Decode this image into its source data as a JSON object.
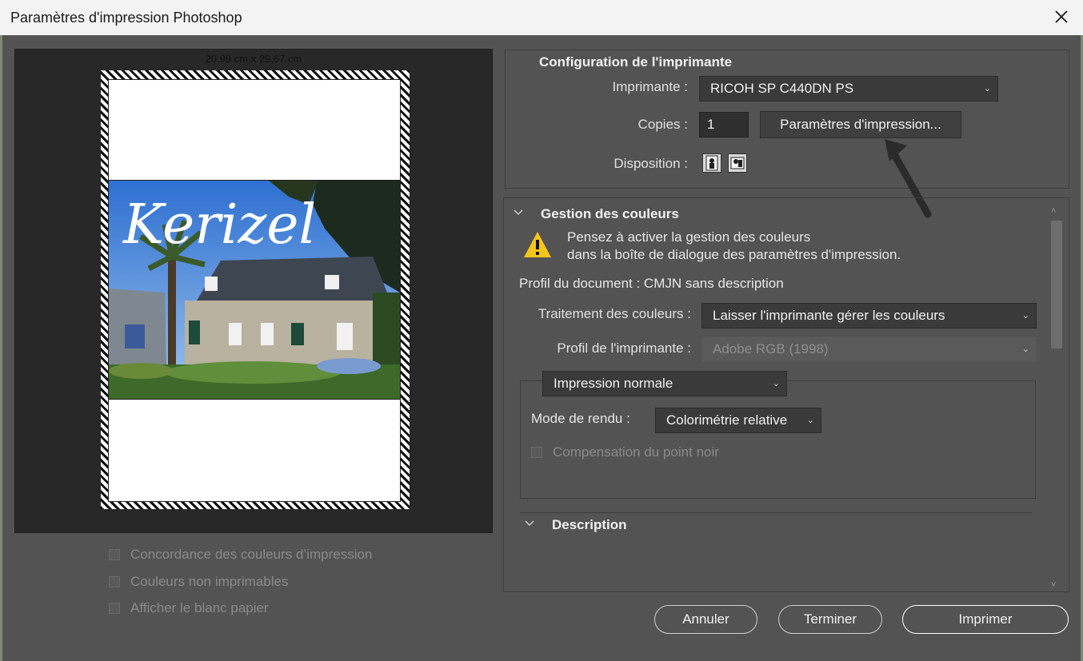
{
  "window": {
    "title": "Paramètres d'impression Photoshop"
  },
  "preview": {
    "page_size": "20,99 cm x 29,67 cm",
    "logo_text": "Kerizel",
    "options": [
      "Concordance des couleurs d’impression",
      "Couleurs non imprimables",
      "Afficher le blanc papier"
    ]
  },
  "printer_config": {
    "title": "Configuration de l'imprimante",
    "printer_label": "Imprimante :",
    "printer_value": "RICOH SP C440DN PS",
    "copies_label": "Copies :",
    "copies_value": "1",
    "print_settings_button": "Paramètres d'impression...",
    "layout_label": "Disposition :"
  },
  "color_management": {
    "title": "Gestion des couleurs",
    "warning_line1": "Pensez à activer la gestion des couleurs",
    "warning_line2": "dans la boîte de dialogue des paramètres d'impression.",
    "doc_profile": "Profil du document : CMJN sans description",
    "color_handling_label": "Traitement des couleurs :",
    "color_handling_value": "Laisser l'imprimante gérer les couleurs",
    "printer_profile_label": "Profil de l'imprimante :",
    "printer_profile_value": "Adobe RGB (1998)",
    "print_mode_value": "Impression normale",
    "render_mode_label": "Mode de rendu :",
    "render_mode_value": "Colorimétrie relative",
    "black_point_label": "Compensation du point noir"
  },
  "description": {
    "title": "Description"
  },
  "buttons": {
    "cancel": "Annuler",
    "done": "Terminer",
    "print": "Imprimer"
  },
  "colors": {
    "dialog_bg": "#535353",
    "preview_bg": "#282828",
    "field_bg": "#3a3a3a",
    "warning": "#f5c518"
  }
}
